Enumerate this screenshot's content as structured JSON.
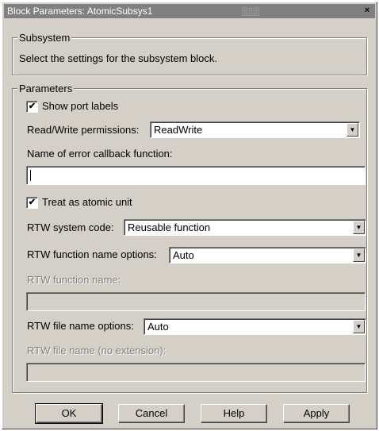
{
  "window": {
    "title": "Block Parameters: AtomicSubsys1",
    "close_glyph": "×"
  },
  "subsystem": {
    "legend": "Subsystem",
    "description": "Select the settings for the subsystem block."
  },
  "parameters": {
    "legend": "Parameters",
    "show_port_labels": {
      "label": "Show port labels",
      "checked": true
    },
    "read_write": {
      "label": "Read/Write permissions:",
      "value": "ReadWrite"
    },
    "error_callback": {
      "label": "Name of error callback function:",
      "value": ""
    },
    "treat_atomic": {
      "label": "Treat as atomic unit",
      "checked": true
    },
    "rtw_system_code": {
      "label": "RTW system code:",
      "value": "Reusable function"
    },
    "rtw_function_name_options": {
      "label": "RTW function name options:",
      "value": "Auto"
    },
    "rtw_function_name": {
      "label": "RTW function name:",
      "value": ""
    },
    "rtw_file_name_options": {
      "label": "RTW file name options:",
      "value": "Auto"
    },
    "rtw_file_name": {
      "label": "RTW file name (no extension):",
      "value": ""
    }
  },
  "buttons": {
    "ok": "OK",
    "cancel": "Cancel",
    "help": "Help",
    "apply": "Apply"
  },
  "icons": {
    "check": "✔",
    "dropdown": "▼"
  }
}
